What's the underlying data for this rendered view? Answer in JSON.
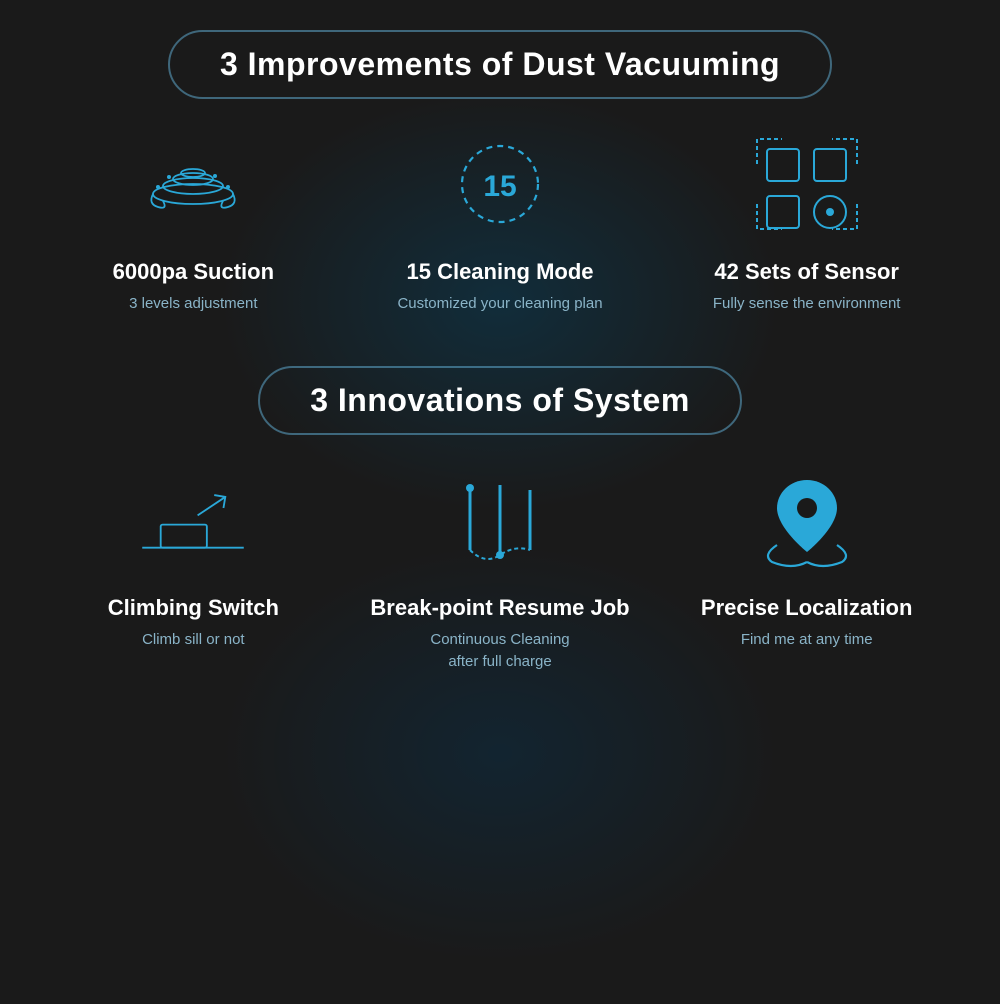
{
  "section1": {
    "badge": "3 Improvements of Dust Vacuuming",
    "features": [
      {
        "id": "suction",
        "title": "6000pa Suction",
        "subtitle": "3 levels adjustment",
        "icon": "suction-icon"
      },
      {
        "id": "cleaning-mode",
        "title": "15 Cleaning Mode",
        "subtitle": "Customized your cleaning plan",
        "icon": "cleaning-mode-icon"
      },
      {
        "id": "sensor",
        "title": "42 Sets of Sensor",
        "subtitle": "Fully sense the environment",
        "icon": "sensor-icon"
      }
    ]
  },
  "section2": {
    "badge": "3 Innovations of System",
    "features": [
      {
        "id": "climbing",
        "title": "Climbing Switch",
        "subtitle": "Climb sill or not",
        "icon": "climbing-icon"
      },
      {
        "id": "resume",
        "title": "Break-point Resume Job",
        "subtitle": "Continuous Cleaning\nafter full charge",
        "icon": "resume-icon"
      },
      {
        "id": "localization",
        "title": "Precise Localization",
        "subtitle": "Find me at any time",
        "icon": "localization-icon"
      }
    ]
  }
}
